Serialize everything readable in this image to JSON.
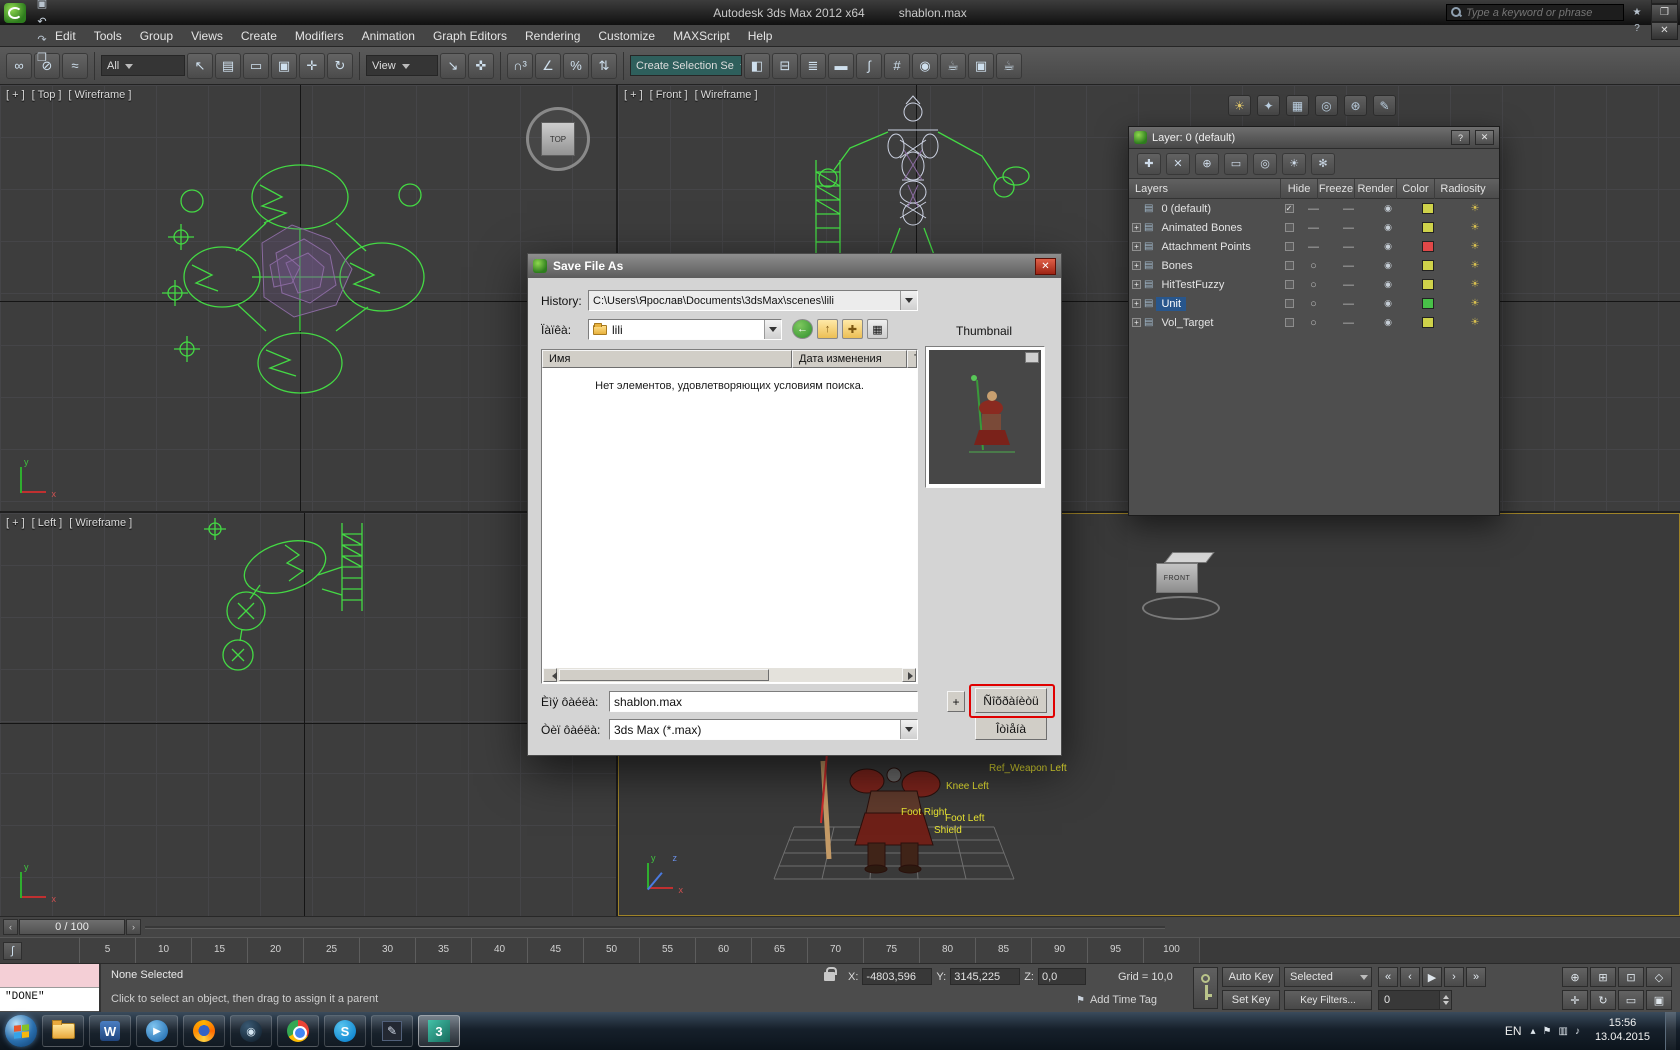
{
  "window": {
    "title": "Autodesk 3ds Max  2012 x64",
    "document": "shablon.max",
    "search_placeholder": "Type a keyword or phrase",
    "quick_access": [
      {
        "name": "new-scene-icon",
        "glyph": "❏"
      },
      {
        "name": "open-file-icon",
        "glyph": "❐"
      },
      {
        "name": "save-file-icon",
        "glyph": "▣"
      },
      {
        "name": "undo-icon",
        "glyph": "↶"
      },
      {
        "name": "redo-icon",
        "glyph": "↷"
      },
      {
        "name": "project-folder-icon",
        "glyph": "❒"
      }
    ],
    "help_icons": [
      {
        "name": "communities-icon",
        "glyph": "✦"
      },
      {
        "name": "favorites-icon",
        "glyph": "★"
      },
      {
        "name": "info-center-icon",
        "glyph": "?"
      }
    ],
    "window_controls": [
      {
        "name": "minimize-button",
        "glyph": "—"
      },
      {
        "name": "restore-button",
        "glyph": "❐"
      },
      {
        "name": "close-button",
        "glyph": "✕"
      }
    ]
  },
  "menu": {
    "items": [
      "Edit",
      "Tools",
      "Group",
      "Views",
      "Create",
      "Modifiers",
      "Animation",
      "Graph Editors",
      "Rendering",
      "Customize",
      "MAXScript",
      "Help"
    ]
  },
  "toolbar": {
    "group1": [
      {
        "name": "select-and-link-icon",
        "glyph": "∞"
      },
      {
        "name": "unlink-selection-icon",
        "glyph": "⊘"
      },
      {
        "name": "bind-to-space-warp-icon",
        "glyph": "≈"
      }
    ],
    "selection_filter": "All",
    "group2": [
      {
        "name": "select-object-icon",
        "glyph": "↖"
      },
      {
        "name": "select-by-name-icon",
        "glyph": "▤"
      },
      {
        "name": "rectangular-selection-icon",
        "glyph": "▭"
      },
      {
        "name": "window-crossing-icon",
        "glyph": "▣"
      },
      {
        "name": "select-and-move-icon",
        "glyph": "✛"
      },
      {
        "name": "select-and-rotate-icon",
        "glyph": "↻"
      }
    ],
    "reference_coordsys": "View",
    "group3": [
      {
        "name": "select-and-scale-icon",
        "glyph": "↘"
      },
      {
        "name": "select-and-manipulate-icon",
        "glyph": "✜"
      }
    ],
    "group4": [
      {
        "name": "snaps-toggle-icon",
        "glyph": "∩³"
      },
      {
        "name": "angle-snap-icon",
        "glyph": "∠"
      },
      {
        "name": "percent-snap-icon",
        "glyph": "%"
      },
      {
        "name": "spinner-snap-icon",
        "glyph": "⇅"
      }
    ],
    "named_sets": "Create Selection Se",
    "group5": [
      {
        "name": "mirror-icon",
        "glyph": "◧"
      },
      {
        "name": "align-icon",
        "glyph": "⊟"
      },
      {
        "name": "layer-manager-icon",
        "glyph": "≣"
      },
      {
        "name": "ribbon-toggle-icon",
        "glyph": "▬"
      },
      {
        "name": "curve-editor-icon",
        "glyph": "∫"
      },
      {
        "name": "schematic-view-icon",
        "glyph": "#"
      },
      {
        "name": "material-editor-icon",
        "glyph": "◉"
      },
      {
        "name": "render-setup-icon",
        "glyph": "☕"
      },
      {
        "name": "rendered-frame-icon",
        "glyph": "▣"
      },
      {
        "name": "render-production-icon",
        "glyph": "☕"
      }
    ]
  },
  "float_toolbar": [
    {
      "name": "daylight-icon",
      "glyph": "☀"
    },
    {
      "name": "effects-icon",
      "glyph": "✦"
    },
    {
      "name": "grid-tool-icon",
      "glyph": "▦"
    },
    {
      "name": "target-tool-icon",
      "glyph": "◎"
    },
    {
      "name": "region-tool-icon",
      "glyph": "⊛"
    },
    {
      "name": "edit-tool-icon",
      "glyph": "✎"
    }
  ],
  "viewports": {
    "top": {
      "plus": "[ + ]",
      "view": "[ Top ]",
      "shading": "[ Wireframe ]",
      "cube_label": "TOP"
    },
    "front": {
      "plus": "[ + ]",
      "view": "[ Front ]",
      "shading": "[ Wireframe ]"
    },
    "left": {
      "plus": "[ + ]",
      "view": "[ Left ]",
      "shading": "[ Wireframe ]"
    },
    "perspective": {
      "cube_label": "FRONT"
    },
    "axis": {
      "x": "x",
      "y": "y",
      "z": "z"
    }
  },
  "scene_labels": [
    {
      "text": "Ref_Weapon Left"
    },
    {
      "text": "Knee Left"
    },
    {
      "text": "Foot Right"
    },
    {
      "text": "Foot Left"
    },
    {
      "text": "Shield"
    }
  ],
  "layer_window": {
    "title": "Layer: 0 (default)",
    "help_button": "?",
    "close_button": "✕",
    "tools": [
      {
        "name": "new-layer-icon",
        "glyph": "✚"
      },
      {
        "name": "delete-layer-icon",
        "glyph": "✕"
      },
      {
        "name": "add-selection-to-layer-icon",
        "glyph": "⊕"
      },
      {
        "name": "select-objects-in-layer-icon",
        "glyph": "▭"
      },
      {
        "name": "set-current-layer-icon",
        "glyph": "◎"
      },
      {
        "name": "hide-toggle-icon",
        "glyph": "☀"
      },
      {
        "name": "freeze-toggle-icon",
        "glyph": "✻"
      }
    ],
    "columns": [
      "Layers",
      "Hide",
      "Freeze",
      "Render",
      "Color",
      "Radiosity"
    ],
    "rows": [
      {
        "expand": "",
        "icon": "▤",
        "name": "0 (default)",
        "current": "✓",
        "hide": "—",
        "freeze": "—",
        "render": "◉",
        "color": "#cfd24a",
        "radiosity": "☀",
        "selected": false
      },
      {
        "expand": "+",
        "icon": "▤",
        "name": "Animated Bones",
        "current": "",
        "hide": "—",
        "freeze": "—",
        "render": "◉",
        "color": "#cfd24a",
        "radiosity": "☀",
        "selected": false
      },
      {
        "expand": "+",
        "icon": "▤",
        "name": "Attachment Points",
        "current": "",
        "hide": "—",
        "freeze": "—",
        "render": "◉",
        "color": "#e04848",
        "radiosity": "☀",
        "selected": false
      },
      {
        "expand": "+",
        "icon": "▤",
        "name": "Bones",
        "current": "",
        "hide": "○",
        "freeze": "—",
        "render": "◉",
        "color": "#cfd24a",
        "radiosity": "☀",
        "selected": false
      },
      {
        "expand": "+",
        "icon": "▤",
        "name": "HitTestFuzzy",
        "current": "",
        "hide": "○",
        "freeze": "—",
        "render": "◉",
        "color": "#cfd24a",
        "radiosity": "☀",
        "selected": false
      },
      {
        "expand": "+",
        "icon": "▤",
        "name": "Unit",
        "current": "",
        "hide": "○",
        "freeze": "—",
        "render": "◉",
        "color": "#48c048",
        "radiosity": "☀",
        "selected": true
      },
      {
        "expand": "+",
        "icon": "▤",
        "name": "Vol_Target",
        "current": "",
        "hide": "○",
        "freeze": "—",
        "render": "◉",
        "color": "#cfd24a",
        "radiosity": "☀",
        "selected": false
      }
    ]
  },
  "save_dialog": {
    "title": "Save File As",
    "close_button": "✕",
    "history_label": "History:",
    "history_value": "C:\\Users\\Ярослав\\Documents\\3dsMax\\scenes\\lili",
    "folder_label": "Ïàïêà:",
    "folder_value": "lili",
    "nav_icons": [
      {
        "name": "go-back-icon",
        "glyph": "←"
      },
      {
        "name": "up-one-level-icon",
        "glyph": "↑"
      },
      {
        "name": "new-folder-icon",
        "glyph": "✚"
      },
      {
        "name": "view-menu-icon",
        "glyph": "▦"
      }
    ],
    "columns": {
      "name": "Имя",
      "date": "Дата изменения",
      "type": "Ти"
    },
    "empty_message": "Нет элементов, удовлетворяющих условиям поиска.",
    "thumbnail_label": "Thumbnail",
    "filename_label": "Èìÿ ôàéëà:",
    "filename_value": "shablon.max",
    "filetype_label": "Òèï ôàéëà:",
    "filetype_value": "3ds Max (*.max)",
    "plus_button": "+",
    "save_button": "Ñîõðàíèòü",
    "cancel_button": "Îòìåíà"
  },
  "timeline": {
    "prev": "‹",
    "slider": "0 / 100",
    "next": "›",
    "mini_curve_icon": "∫",
    "ticks": [
      "5",
      "10",
      "15",
      "20",
      "25",
      "30",
      "35",
      "40",
      "45",
      "50",
      "55",
      "60",
      "65",
      "70",
      "75",
      "80",
      "85",
      "90",
      "95",
      "100"
    ]
  },
  "status_bar": {
    "listener_line2": "\"DONE\"",
    "selection_status": "None Selected",
    "prompt": "Click to select an object, then drag to assign it a parent",
    "x_label": "X:",
    "x_value": "-4803,596",
    "y_label": "Y:",
    "y_value": "3145,225",
    "z_label": "Z:",
    "z_value": "0,0",
    "grid_label": "Grid = 10,0",
    "time_tag_icon": "⚑",
    "add_time_tag": "Add Time Tag",
    "auto_key": "Auto Key",
    "set_key": "Set Key",
    "key_mode": "Selected",
    "key_filters": "Key Filters...",
    "transport": [
      {
        "name": "go-to-start-icon",
        "glyph": "«"
      },
      {
        "name": "previous-frame-icon",
        "glyph": "‹"
      },
      {
        "name": "play-icon",
        "glyph": "▶"
      },
      {
        "name": "next-frame-icon",
        "glyph": "›"
      },
      {
        "name": "go-to-end-icon",
        "glyph": "»"
      }
    ],
    "frame_value": "0",
    "nav_row1": [
      {
        "name": "zoom-icon",
        "glyph": "⊕"
      },
      {
        "name": "zoom-all-icon",
        "glyph": "⊞"
      },
      {
        "name": "zoom-extents-icon",
        "glyph": "⊡"
      },
      {
        "name": "field-of-view-icon",
        "glyph": "◇"
      }
    ],
    "nav_row2": [
      {
        "name": "pan-icon",
        "glyph": "✛"
      },
      {
        "name": "arc-rotate-icon",
        "glyph": "↻"
      },
      {
        "name": "zoom-region-icon",
        "glyph": "▭"
      },
      {
        "name": "maximize-viewport-icon",
        "glyph": "▣"
      }
    ]
  },
  "taskbar": {
    "apps": [
      {
        "name": "explorer-icon",
        "app": "explorer",
        "glyph": ""
      },
      {
        "name": "word-icon",
        "app": "word",
        "glyph": "W"
      },
      {
        "name": "media-player-icon",
        "app": "media",
        "glyph": "▶"
      },
      {
        "name": "firefox-icon",
        "app": "firefox",
        "glyph": ""
      },
      {
        "name": "steam-icon",
        "app": "steam",
        "glyph": "◉"
      },
      {
        "name": "chrome-icon",
        "app": "chrome",
        "glyph": ""
      },
      {
        "name": "skype-icon",
        "app": "skype",
        "glyph": "S"
      },
      {
        "name": "pen-app-icon",
        "app": "pen",
        "glyph": "✎"
      },
      {
        "name": "3ds-max-taskbar-icon",
        "app": "max",
        "glyph": "3",
        "active": true
      }
    ],
    "tray": {
      "lang": "EN",
      "icons": [
        {
          "name": "hidden-icons-arrow",
          "glyph": "▴"
        },
        {
          "name": "action-center-icon",
          "glyph": "⚑"
        },
        {
          "name": "network-icon",
          "glyph": "▥"
        },
        {
          "name": "volume-icon",
          "glyph": "♪"
        }
      ],
      "time": "15:56",
      "date": "13.04.2015"
    }
  }
}
